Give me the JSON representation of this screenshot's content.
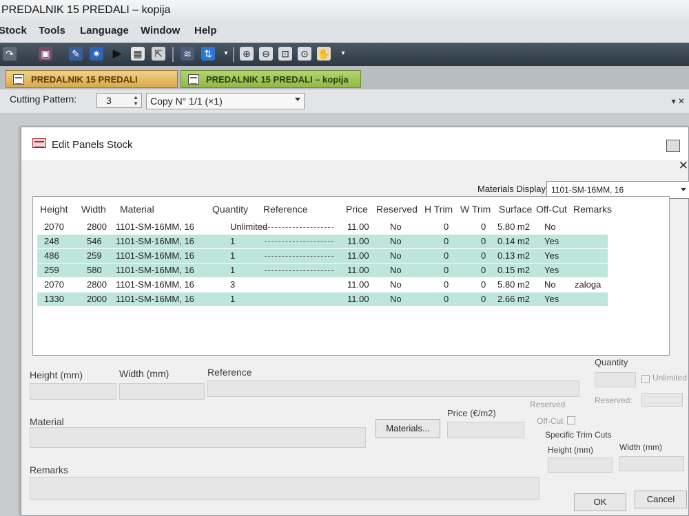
{
  "window": {
    "title": "PREDALNIK 15 PREDALI – kopija"
  },
  "menu": [
    "Stock",
    "Tools",
    "Language",
    "Window",
    "Help"
  ],
  "tabs": [
    {
      "label": "PREDALNIK 15 PREDALI",
      "active": true
    },
    {
      "label": "PREDALNIK 15 PREDALI – kopija",
      "active": false
    }
  ],
  "cutting": {
    "label": "Cutting Pattern:",
    "value": "3",
    "copy": "Copy N° 1/1 (×1)"
  },
  "dialog": {
    "title": "Edit Panels Stock",
    "materials_display_label": "Materials Display",
    "materials_display_value": "1101-SM-16MM, 16"
  },
  "table": {
    "columns": [
      "Height",
      "Width",
      "Material",
      "Quantity",
      "Reference",
      "Price",
      "Reserved",
      "H Trim",
      "W Trim",
      "Surface",
      "Off-Cut",
      "Remarks"
    ],
    "rows": [
      {
        "height": "2070",
        "width": "2800",
        "material": "1101-SM-16MM, 16",
        "quantity": "Unlimited",
        "price": "11.00",
        "reserved": "No",
        "htrim": "0",
        "wtrim": "0",
        "surface": "5.80 m2",
        "offcut": "No",
        "remarks": "",
        "highlight": false
      },
      {
        "height": "248",
        "width": "546",
        "material": "1101-SM-16MM, 16",
        "quantity": "1",
        "price": "11.00",
        "reserved": "No",
        "htrim": "0",
        "wtrim": "0",
        "surface": "0.14 m2",
        "offcut": "Yes",
        "remarks": "",
        "highlight": true
      },
      {
        "height": "486",
        "width": "259",
        "material": "1101-SM-16MM, 16",
        "quantity": "1",
        "price": "11.00",
        "reserved": "No",
        "htrim": "0",
        "wtrim": "0",
        "surface": "0.13 m2",
        "offcut": "Yes",
        "remarks": "",
        "highlight": true
      },
      {
        "height": "259",
        "width": "580",
        "material": "1101-SM-16MM, 16",
        "quantity": "1",
        "price": "11.00",
        "reserved": "No",
        "htrim": "0",
        "wtrim": "0",
        "surface": "0.15 m2",
        "offcut": "Yes",
        "remarks": "",
        "highlight": true
      },
      {
        "height": "2070",
        "width": "2800",
        "material": "1101-SM-16MM, 16",
        "quantity": "3",
        "price": "11.00",
        "reserved": "No",
        "htrim": "0",
        "wtrim": "0",
        "surface": "5.80 m2",
        "offcut": "No",
        "remarks": "zaloga",
        "highlight": false
      },
      {
        "height": "1330",
        "width": "2000",
        "material": "1101-SM-16MM, 16",
        "quantity": "1",
        "price": "11.00",
        "reserved": "No",
        "htrim": "0",
        "wtrim": "0",
        "surface": "2.66 m2",
        "offcut": "Yes",
        "remarks": "",
        "highlight": true
      }
    ]
  },
  "form": {
    "height_label": "Height (mm)",
    "width_label": "Width (mm)",
    "reference_label": "Reference",
    "quantity_label": "Quantity",
    "unlimited_label": "Unlimited",
    "reserved_label": "Reserved:",
    "reserved_check_label": "Reserved",
    "offcut_label": "Off-Cut",
    "material_label": "Material",
    "materials_button": "Materials...",
    "price_label": "Price (€/m2)",
    "specific_trim_label": "Specific Trim Cuts",
    "trim_height_label": "Height (mm)",
    "trim_width_label": "Width (mm)",
    "remarks_label": "Remarks",
    "ok_button": "OK",
    "cancel_button": "Cancel"
  }
}
